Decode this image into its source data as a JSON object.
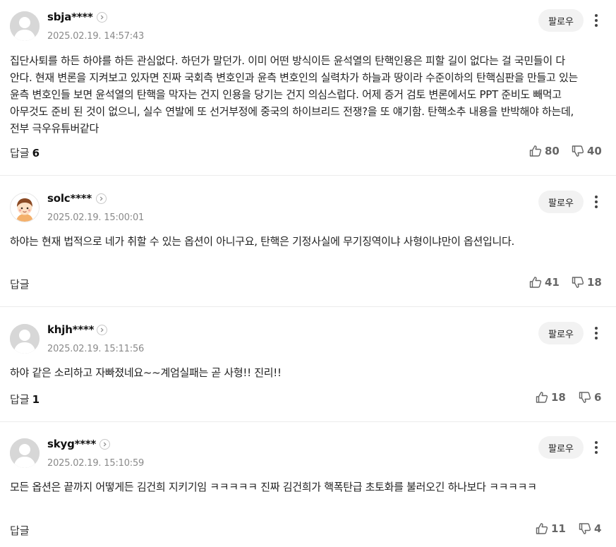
{
  "comments": [
    {
      "username": "sbja****",
      "timestamp": "2025.02.19. 14:57:43",
      "follow_label": "팔로우",
      "avatar": "default-avatar",
      "body": "집단사퇴를 하든 하야를 하든 관심없다. 하던가 말던가. 이미 어떤 방식이든 윤석열의 탄핵인용은 피할 길이 없다는 걸 국민들이 다 안다. 현재 변론을 지켜보고 있자면 진짜 국회측 변호인과 윤측 변호인의 실력차가 하늘과 땅이라 수준이하의 탄핵심판을 만들고 있는 윤측 변호인들 보면 윤석열의 탄핵을 막자는 건지 인용을 당기는 건지 의심스럽다. 어제 증거 검토 변론에서도 PPT 준비도 빼먹고 아무것도 준비 된 것이 없으니, 실수 연발에 또 선거부정에 중국의 하이브리드 전쟁?을 또 얘기함. 탄핵소추 내용을 반박해야 하는데, 전부 극우유튜버같다",
      "reply_label": "답글",
      "reply_count": "6",
      "likes": "80",
      "dislikes": "40"
    },
    {
      "username": "solc****",
      "timestamp": "2025.02.19. 15:00:01",
      "follow_label": "팔로우",
      "avatar": "cartoon-avatar",
      "body": "하야는 현재 법적으로 네가 취할 수 있는 옵션이 아니구요, 탄핵은 기정사실에 무기징역이냐 사형이냐만이 옵션입니다.",
      "reply_label": "답글",
      "reply_count": "",
      "likes": "41",
      "dislikes": "18"
    },
    {
      "username": "khjh****",
      "timestamp": "2025.02.19. 15:11:56",
      "follow_label": "팔로우",
      "avatar": "default-avatar",
      "body": "하야 같은 소리하고 자빠졌네요~~계엄실패는 곧 사형!! 진리!!",
      "reply_label": "답글",
      "reply_count": "1",
      "likes": "18",
      "dislikes": "6"
    },
    {
      "username": "skyg****",
      "timestamp": "2025.02.19. 15:10:59",
      "follow_label": "팔로우",
      "avatar": "default-avatar",
      "body": "모든 옵션은 끝까지 어떻게든 김건희 지키기임 ㅋㅋㅋㅋㅋ 진짜 김건희가 핵폭탄급 초토화를 불러오긴 하나보다 ㅋㅋㅋㅋㅋ",
      "reply_label": "답글",
      "reply_count": "",
      "likes": "11",
      "dislikes": "4"
    }
  ],
  "colors": {
    "text": "#222222",
    "muted": "#8a8a8a",
    "follow_bg": "#f2f2f2",
    "divider": "#ececec"
  }
}
